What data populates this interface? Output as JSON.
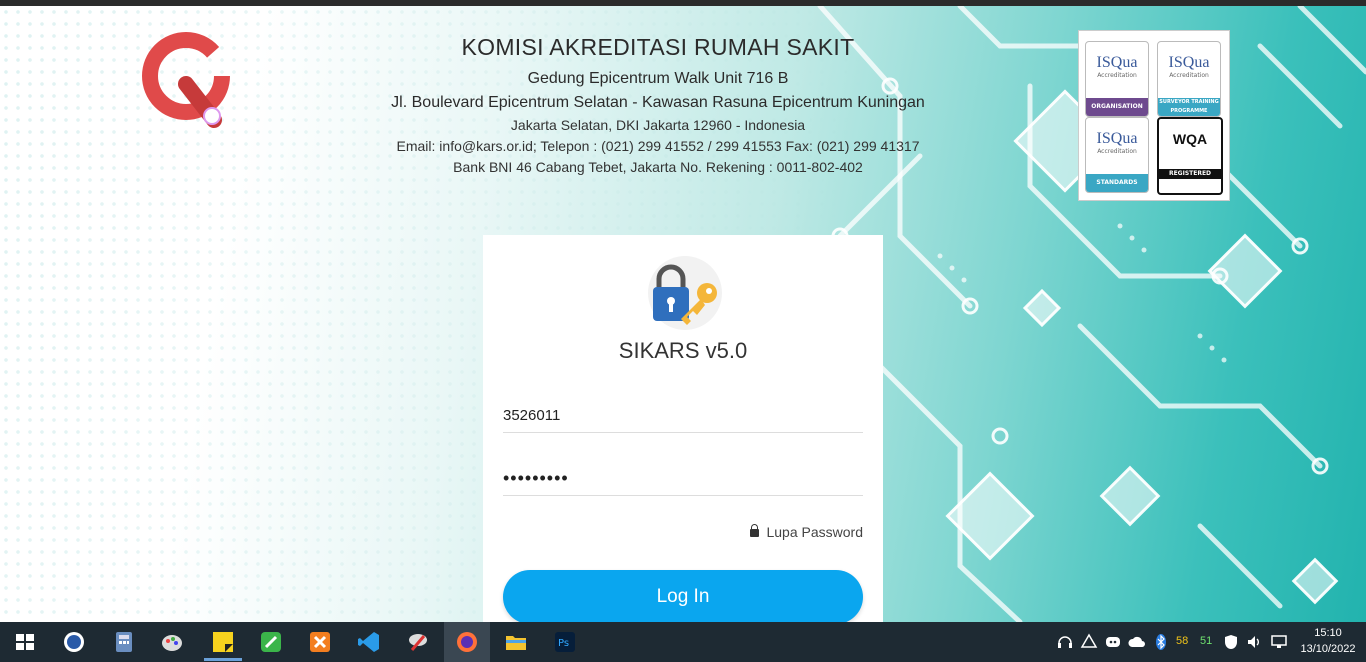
{
  "header": {
    "org_name": "KOMISI AKREDITASI RUMAH SAKIT",
    "address_line1": "Gedung Epicentrum Walk Unit 716 B",
    "address_line2": "Jl. Boulevard Epicentrum Selatan - Kawasan Rasuna Epicentrum Kuningan",
    "address_line3": "Jakarta Selatan, DKI Jakarta 12960 - Indonesia",
    "contact": "Email: info@kars.or.id; Telepon : (021) 299 41552 / 299 41553 Fax: (021) 299 41317",
    "bank": "Bank BNI 46 Cabang Tebet, Jakarta No. Rekening : 0011-802-402"
  },
  "badges": [
    {
      "name": "ISQua",
      "sub": "Accreditation",
      "label": "ORGANISATION",
      "color": "#6e4a8e"
    },
    {
      "name": "ISQua",
      "sub": "Accreditation",
      "label": "SURVEYOR TRAINING PROGRAMME",
      "color": "#3aa7c4"
    },
    {
      "name": "ISQua",
      "sub": "Accreditation",
      "label": "STANDARDS",
      "color": "#3aa7c4"
    },
    {
      "name": "WQA",
      "sub": "",
      "label": "REGISTERED",
      "color": "#111111"
    }
  ],
  "login": {
    "app_title": "SIKARS v5.0",
    "username_value": "3526011",
    "password_value": "•••••••••",
    "forgot_label": "Lupa Password",
    "login_button": "Log In"
  },
  "taskbar": {
    "tray_num1": "58",
    "tray_num2": "51",
    "time": "15:10",
    "date": "13/10/2022"
  },
  "colors": {
    "accent": "#0aa6ef",
    "teal": "#22b3ae",
    "taskbar": "#1e2a33"
  }
}
